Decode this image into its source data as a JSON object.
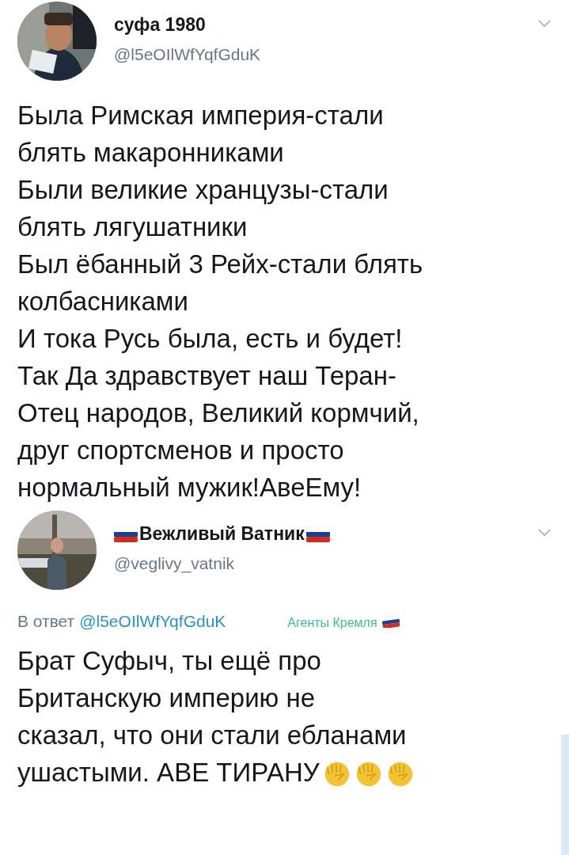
{
  "tweets": [
    {
      "name": "суфа 1980",
      "name_flags": false,
      "handle": "@l5eOIlWfYqfGduK",
      "body": [
        "Была Римская империя-стали",
        "блять макаронниками",
        "Были великие хранцузы-стали",
        "блять лягушатники",
        "Был ёбанный 3 Рейх-стали блять",
        "колбасниками",
        "И тока Русь была, есть и будет!",
        "Так Да здравствует наш Теран-",
        "Отец народов, Великий кормчий,",
        "друг спортсменов и просто",
        "нормальный мужик!АвеЕму!"
      ]
    },
    {
      "name": "Вежливый Ватник",
      "name_flags": true,
      "handle": "@veglivy_vatnik",
      "reply": {
        "prefix": "В ответ",
        "to": "@l5eOIlWfYqfGduK",
        "badge": "Агенты Кремля"
      },
      "body": [
        "Брат Суфыч, ты ещё про",
        "Британскую империю не",
        "сказал, что они стали ебланами",
        "ушастыми. АВЕ ТИРАНУ"
      ],
      "trailing_fists": true
    }
  ]
}
